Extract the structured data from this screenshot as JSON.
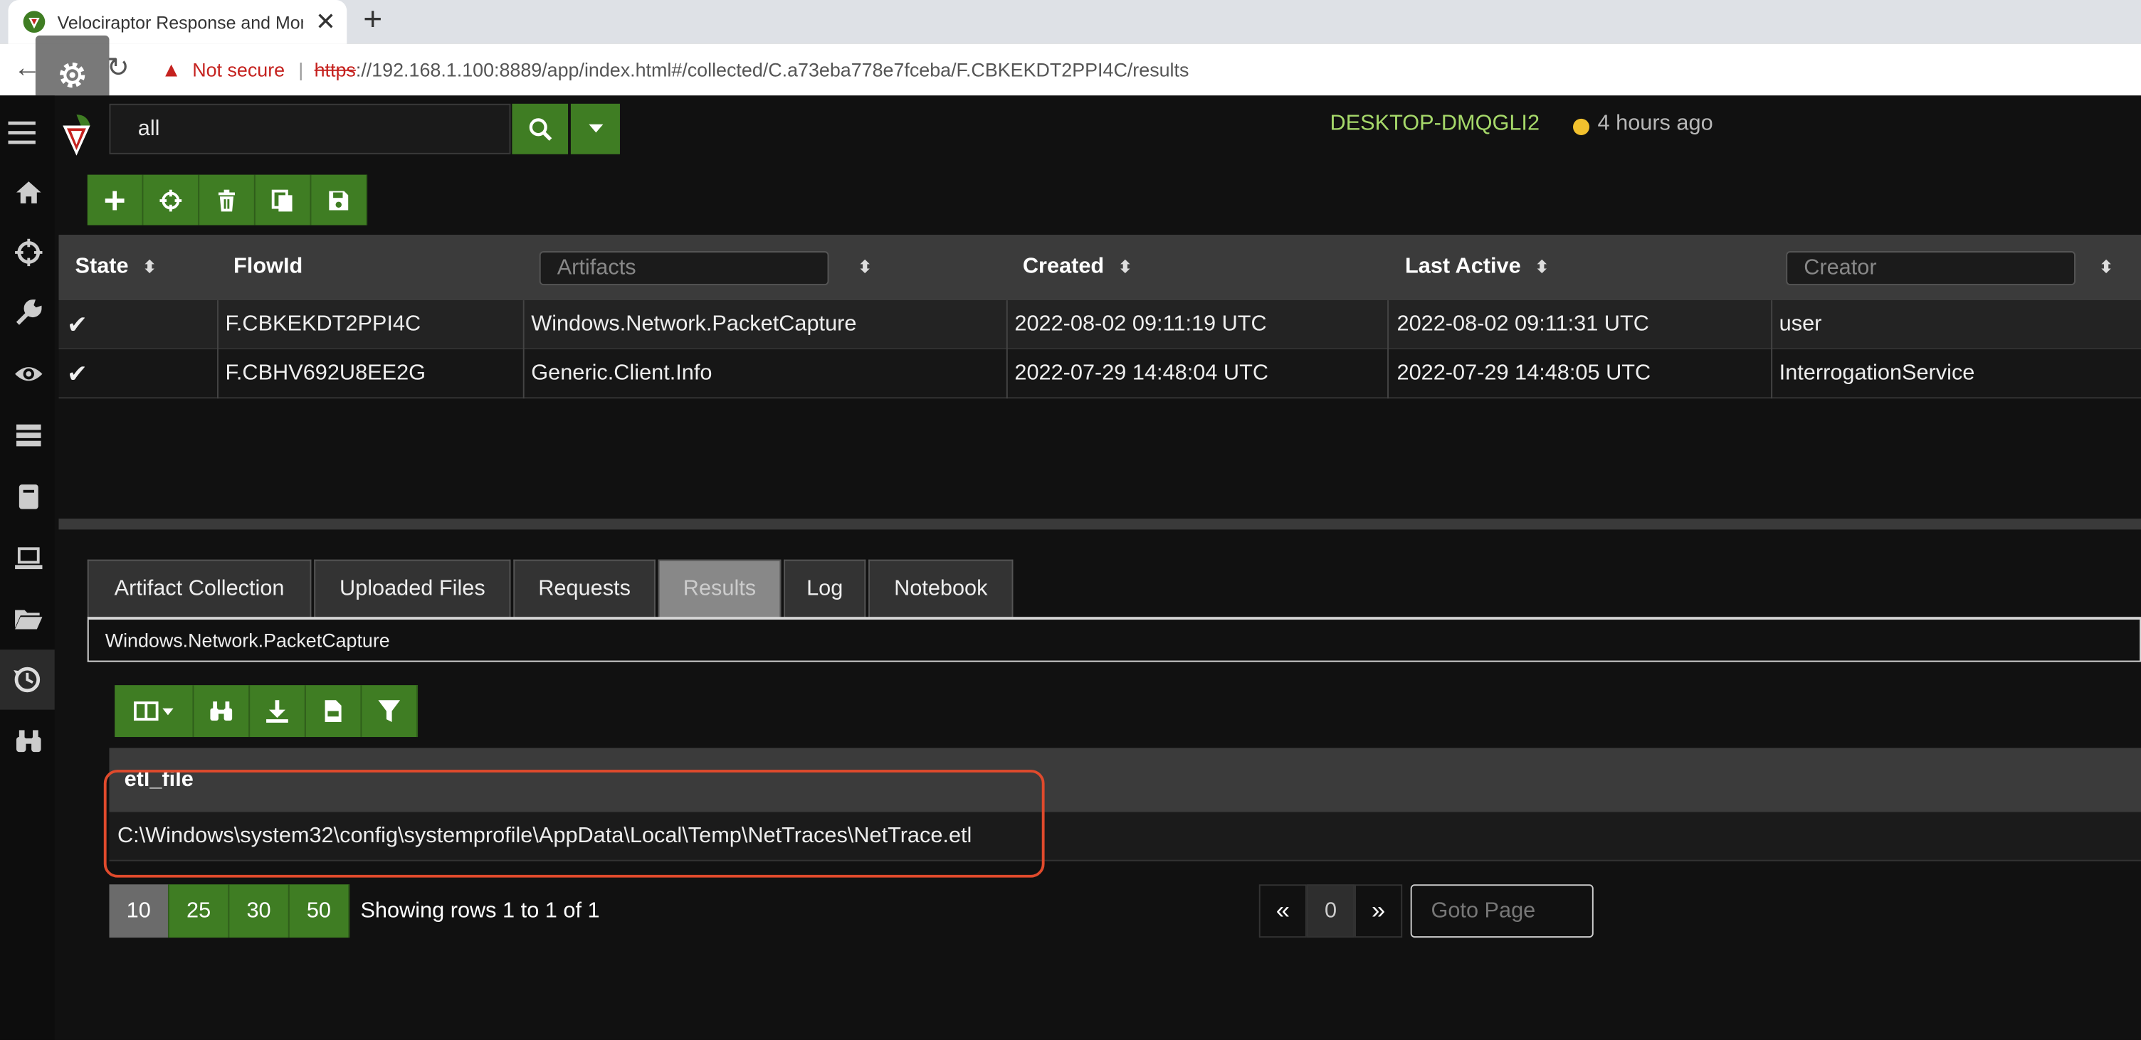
{
  "browser": {
    "tab_title": "Velociraptor Response and Moni",
    "tab_close": "✕",
    "new_tab": "+",
    "not_secure": "Not secure",
    "separator": "|",
    "url_scheme": "https",
    "url_rest": "://192.168.1.100:8889/app/index.html#/collected/C.a73eba778e7fceba/F.CBKEKDT2PPI4C/results"
  },
  "header": {
    "search_value": "all",
    "hostname": "DESKTOP-DMQGLI2",
    "last_seen": "4 hours ago",
    "status_color": "#f2c12e"
  },
  "flows_table": {
    "columns": {
      "state": "State",
      "flowid": "FlowId",
      "artifacts_placeholder": "Artifacts",
      "created": "Created",
      "last_active": "Last Active",
      "creator_placeholder": "Creator"
    },
    "sort_glyph": "⬍",
    "rows": [
      {
        "state": "✔",
        "flowid": "F.CBKEKDT2PPI4C",
        "artifacts": "Windows.Network.PacketCapture",
        "created": "2022-08-02 09:11:19 UTC",
        "last_active": "2022-08-02 09:11:31 UTC",
        "creator": "user"
      },
      {
        "state": "✔",
        "flowid": "F.CBHV692U8EE2G",
        "artifacts": "Generic.Client.Info",
        "created": "2022-07-29 14:48:04 UTC",
        "last_active": "2022-07-29 14:48:05 UTC",
        "creator": "InterrogationService"
      }
    ]
  },
  "tabs": [
    "Artifact Collection",
    "Uploaded Files",
    "Requests",
    "Results",
    "Log",
    "Notebook"
  ],
  "active_tab": "Results",
  "artifact_name": "Windows.Network.PacketCapture",
  "results": {
    "column": "etl_file",
    "rows": [
      "C:\\Windows\\system32\\config\\systemprofile\\AppData\\Local\\Temp\\NetTraces\\NetTrace.etl"
    ]
  },
  "pagination": {
    "sizes": [
      "10",
      "25",
      "30",
      "50"
    ],
    "active_size": "10",
    "showing": "Showing rows 1 to 1 of 1",
    "prev": "«",
    "page": "0",
    "next": "»",
    "goto_placeholder": "Goto Page"
  },
  "colors": {
    "accent_green": "#3f7d23",
    "hostname_green": "#a6d96a",
    "highlight_red": "#e04a2c"
  },
  "icons": {
    "sidebar": [
      "menu-icon",
      "home-icon",
      "crosshair-icon",
      "wrench-icon",
      "eye-icon",
      "server-icon",
      "book-icon",
      "laptop-icon",
      "folder-icon",
      "history-icon",
      "binoculars-icon"
    ],
    "toolbar": [
      "plus-icon",
      "crosshair-icon",
      "trash-icon",
      "copy-icon",
      "save-icon"
    ],
    "results_toolbar": [
      "columns-icon",
      "binoculars-icon",
      "download-icon",
      "csv-file-icon",
      "filter-icon"
    ]
  }
}
